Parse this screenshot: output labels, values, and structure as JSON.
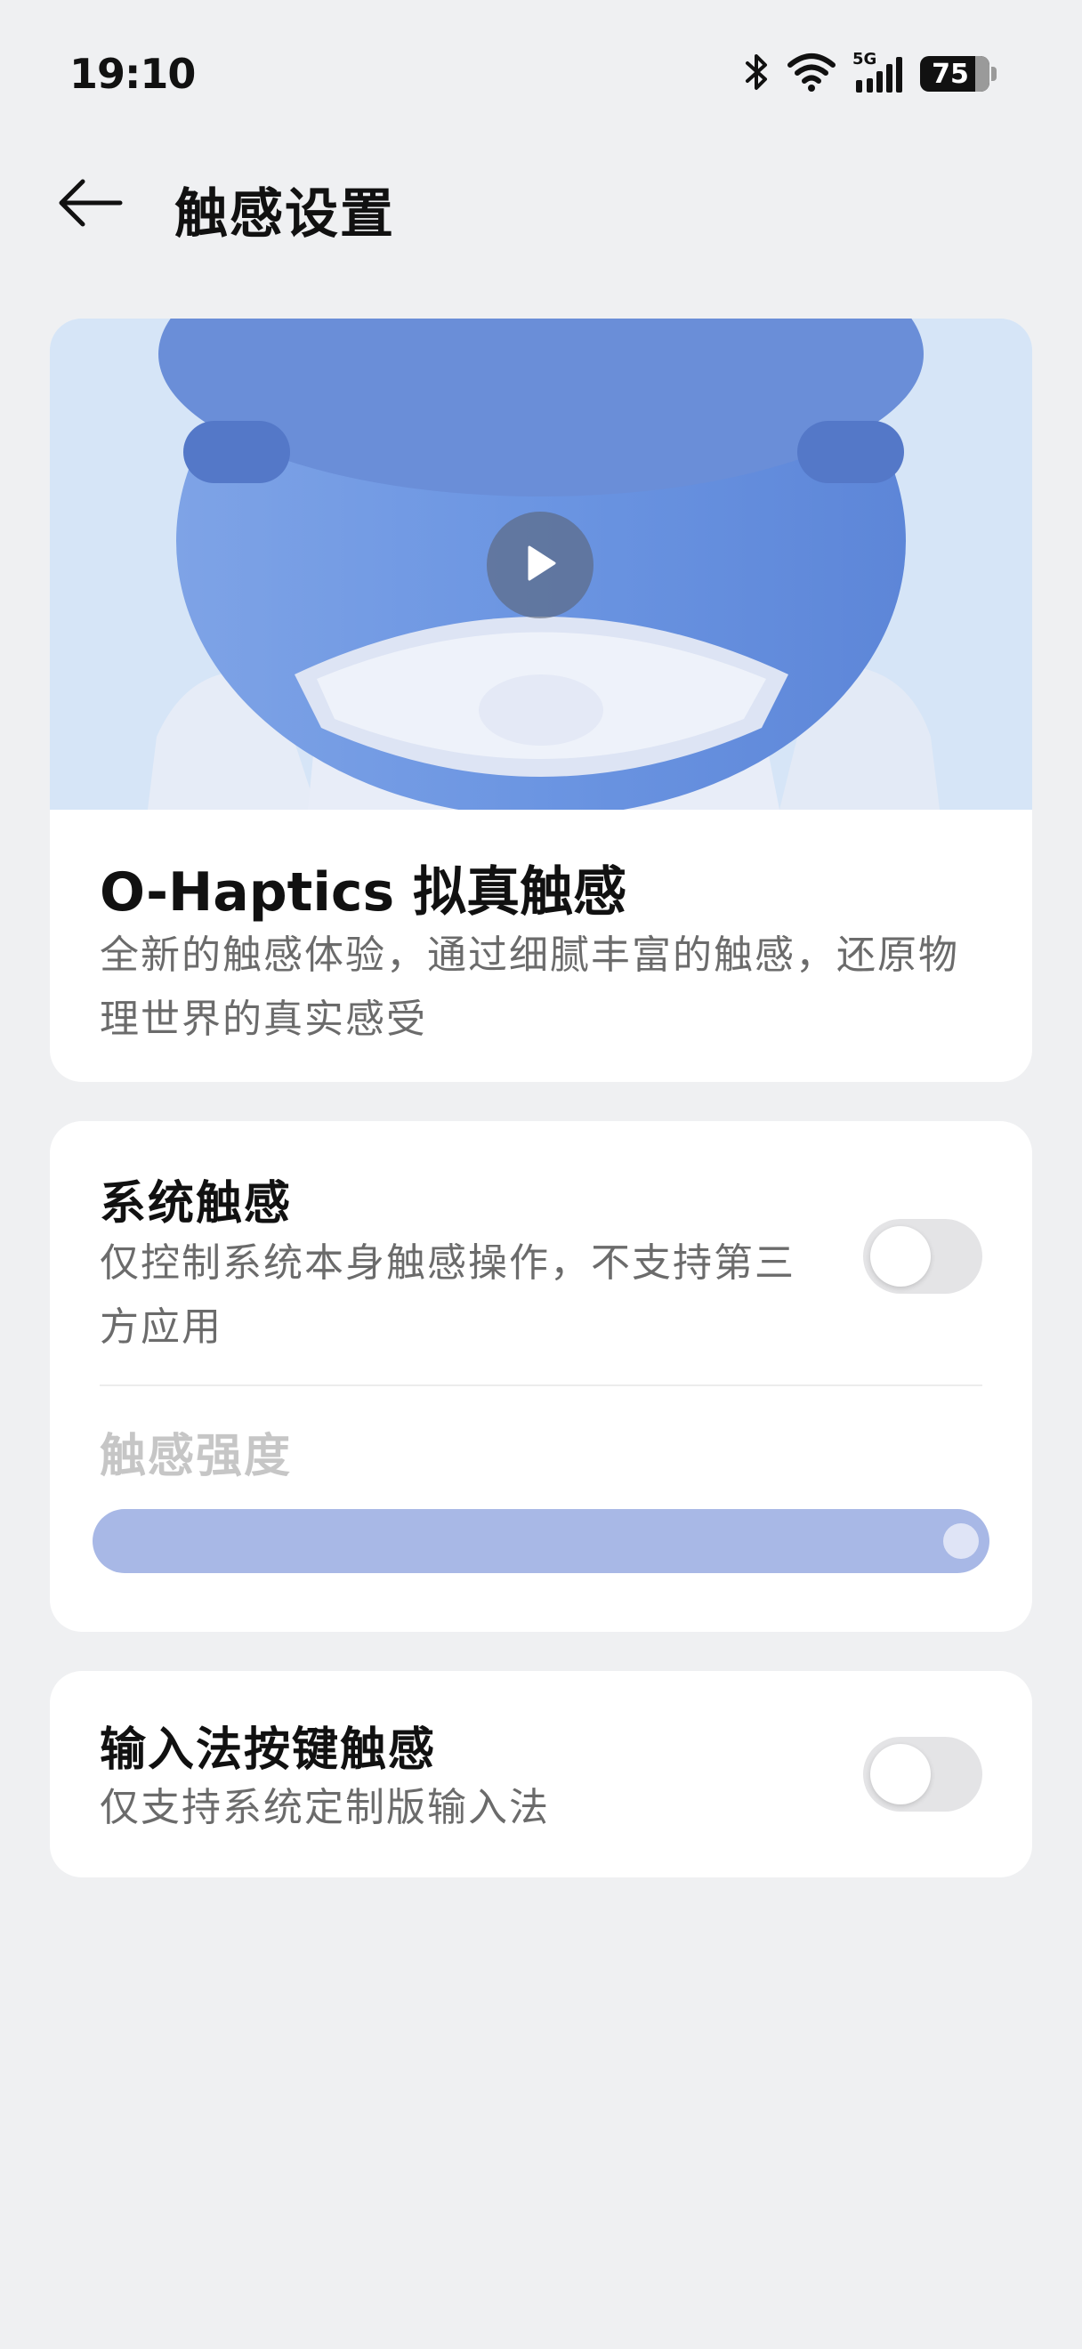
{
  "status_bar": {
    "time": "19:10",
    "network": "5G",
    "battery": "75"
  },
  "header": {
    "title": "触感设置"
  },
  "hero": {
    "title": "O-Haptics 拟真触感",
    "description": "全新的触感体验，通过细腻丰富的触感，还原物理世界的真实感受"
  },
  "system_haptics": {
    "title": "系统触感",
    "description": "仅控制系统本身触感操作，不支持第三方应用",
    "enabled": false,
    "intensity_label": "触感强度",
    "intensity_value": 1.0
  },
  "ime_haptics": {
    "title": "输入法按键触感",
    "description": "仅支持系统定制版输入法",
    "enabled": false
  },
  "colors": {
    "background": "#eff0f2",
    "card": "#ffffff",
    "slider_disabled": "#a8b8e6",
    "toggle_off": "#e4e4e6"
  }
}
